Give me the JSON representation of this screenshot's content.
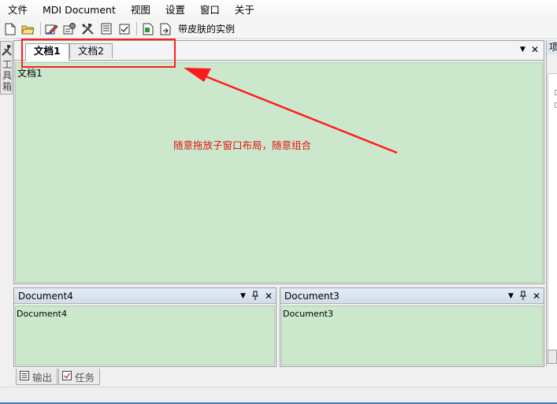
{
  "menu": {
    "items": [
      "文件",
      "MDI Document",
      "视图",
      "设置",
      "窗口",
      "关于"
    ]
  },
  "toolbar": {
    "buttons": [
      "new-file-icon",
      "open-folder-icon",
      "edit-icon",
      "properties-icon",
      "tools-icon",
      "list-icon",
      "task-check-icon",
      "document-icon",
      "export-icon"
    ],
    "label": "带皮肤的实例"
  },
  "left_strip": {
    "label": "工具箱"
  },
  "main_tabs": [
    {
      "label": "文档1",
      "active": true
    },
    {
      "label": "文档2",
      "active": false
    }
  ],
  "main_doc": {
    "text": "文档1"
  },
  "tab_controls": {
    "dropdown": "▼",
    "close": "✕"
  },
  "annotation": {
    "text": "随意拖放子窗口布局，随意组合",
    "color": "#e01414"
  },
  "panes": [
    {
      "title": "Document4",
      "body": "Document4"
    },
    {
      "title": "Document3",
      "body": "Document3"
    }
  ],
  "pane_controls": {
    "dropdown": "▼",
    "pin": "📌",
    "close": "✕"
  },
  "bottom_tabs": [
    {
      "label": "输出",
      "icon": "output-icon"
    },
    {
      "label": "任务",
      "icon": "task-icon"
    }
  ],
  "right_panel": {
    "title": "项"
  },
  "colors": {
    "doc_background": "#cce8cc",
    "pane_title": "#d8e2ee",
    "highlight_red": "#ff2020"
  }
}
